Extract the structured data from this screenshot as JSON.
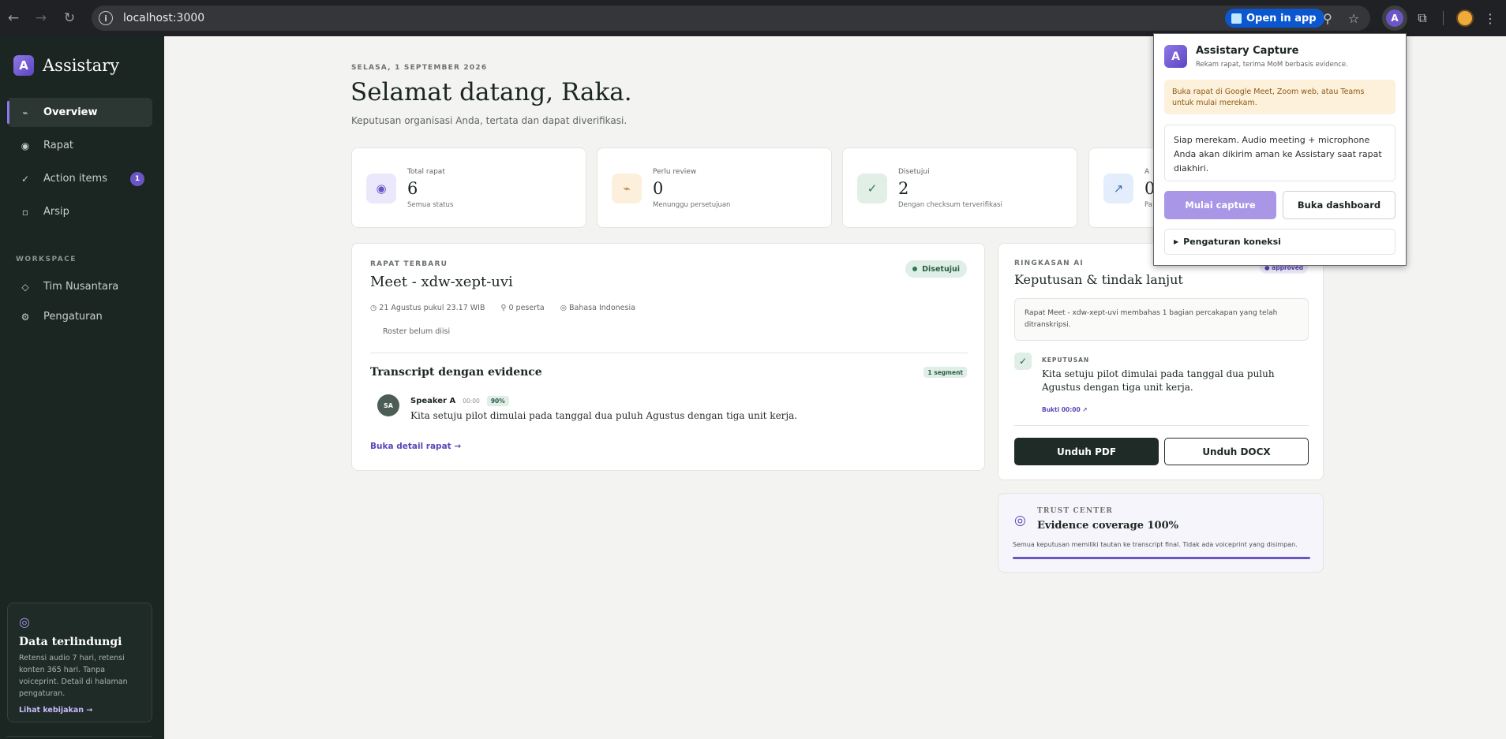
{
  "browser": {
    "url": "localhost:3000",
    "open_in_app": "Open in app",
    "extension_letter": "A"
  },
  "sidebar": {
    "brand": "Assistary",
    "brand_letter": "A",
    "items": [
      {
        "label": "Overview",
        "icon": "pulse-icon",
        "glyph": "⌁",
        "active": true
      },
      {
        "label": "Rapat",
        "icon": "record-icon",
        "glyph": "◉"
      },
      {
        "label": "Action items",
        "icon": "check-icon",
        "glyph": "✓",
        "badge": "1"
      },
      {
        "label": "Arsip",
        "icon": "archive-icon",
        "glyph": "▫"
      }
    ],
    "workspace_label": "WORKSPACE",
    "workspace_items": [
      {
        "label": "Tim Nusantara",
        "icon": "diamond-icon",
        "glyph": "◇"
      },
      {
        "label": "Pengaturan",
        "icon": "gear-icon",
        "glyph": "⚙"
      }
    ],
    "protect": {
      "icon_glyph": "◎",
      "title": "Data terlindungi",
      "text": "Retensi audio 7 hari, retensi konten 365 hari. Tanpa voiceprint. Detail di halaman pengaturan.",
      "link": "Lihat kebijakan →"
    }
  },
  "header": {
    "date": "SELASA, 1 SEPTEMBER 2026",
    "welcome": "Selamat datang, Raka.",
    "subtitle": "Keputusan organisasi Anda, tertata dan dapat diverifikasi."
  },
  "stats": [
    {
      "label": "Total rapat",
      "value": "6",
      "sub": "Semua status",
      "glyph": "◉",
      "bg": "#ece8fb",
      "fg": "#6c55c6"
    },
    {
      "label": "Perlu review",
      "value": "0",
      "sub": "Menunggu persetujuan",
      "glyph": "⌁",
      "bg": "#fcefdc",
      "fg": "#b5741a"
    },
    {
      "label": "Disetujui",
      "value": "2",
      "sub": "Dengan checksum terverifikasi",
      "glyph": "✓",
      "bg": "#e1efe7",
      "fg": "#2f7a55"
    },
    {
      "label": "A",
      "value": "0",
      "sub": "Pa",
      "glyph": "↗",
      "bg": "#e3edfb",
      "fg": "#3b6fb8"
    }
  ],
  "meeting": {
    "eyebrow": "RAPAT TERBARU",
    "title": "Meet - xdw-xept-uvi",
    "status": "Disetujui",
    "meta_time": "◷ 21 Agustus pukul 23.17 WIB",
    "meta_people": "⚲ 0 peserta",
    "meta_lang": "◎ Bahasa Indonesia",
    "roster": "Roster belum diisi",
    "transcript_title": "Transcript dengan evidence",
    "segment_count": "1 segment",
    "speaker_initials": "SA",
    "speaker": "Speaker A",
    "timestamp": "00:00",
    "confidence": "90%",
    "utterance": "Kita setuju pilot dimulai pada tanggal dua puluh Agustus dengan tiga unit kerja.",
    "detail_link": "Buka detail rapat →"
  },
  "ai_summary": {
    "eyebrow": "RINGKASAN AI",
    "approved_badge": "● approved",
    "title": "Keputusan & tindak lanjut",
    "summary": "Rapat Meet - xdw-xept-uvi membahas 1 bagian percakapan yang telah ditranskripsi.",
    "decision_label": "KEPUTUSAN",
    "decision": "Kita setuju pilot dimulai pada tanggal dua puluh Agustus dengan tiga unit kerja.",
    "evidence_link": "Bukti 00:00 ↗",
    "pdf_button": "Unduh PDF",
    "docx_button": "Unduh DOCX"
  },
  "trust": {
    "eyebrow": "TRUST CENTER",
    "title": "Evidence coverage 100%",
    "text": "Semua keputusan memiliki tautan ke transcript final. Tidak ada voiceprint yang disimpan.",
    "coverage": 1.0
  },
  "popup": {
    "logo_letter": "A",
    "title": "Assistary Capture",
    "subtitle": "Rekam rapat, terima MoM berbasis evidence.",
    "warning": "Buka rapat di Google Meet, Zoom web, atau Teams untuk mulai merekam.",
    "info": "Siap merekam. Audio meeting + microphone Anda akan dikirim aman ke Assistary saat rapat diakhiri.",
    "start_button": "Mulai capture",
    "dashboard_button": "Buka dashboard",
    "settings": "Pengaturan koneksi"
  },
  "colors": {
    "accent": "#6c55c6",
    "sidebar_bg": "#1b2622",
    "success": "#2f7a55"
  }
}
